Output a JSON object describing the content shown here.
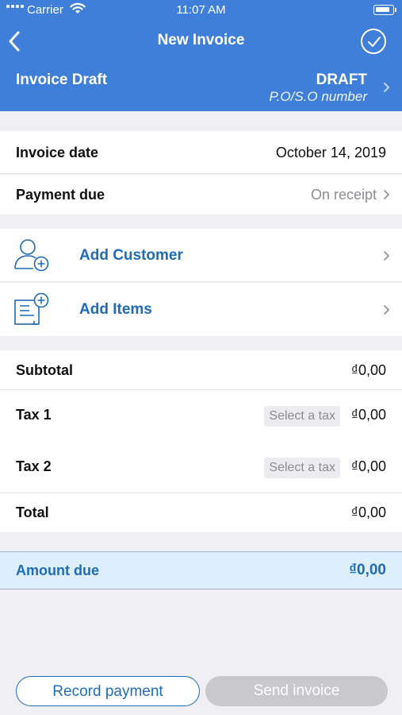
{
  "status_bar": {
    "carrier": "Carrier",
    "time": "11:07 AM"
  },
  "nav": {
    "title": "New Invoice",
    "back_icon": "chevron-left-icon",
    "done_icon": "checkmark-circle-icon"
  },
  "draft": {
    "title": "Invoice Draft",
    "status": "DRAFT",
    "po_number_placeholder": "P.O/S.O number"
  },
  "dates": {
    "invoice_date_label": "Invoice date",
    "invoice_date_value": "October 14, 2019",
    "payment_due_label": "Payment due",
    "payment_due_value": "On receipt"
  },
  "actions": {
    "add_customer": "Add Customer",
    "add_items": "Add Items"
  },
  "totals": {
    "subtotal_label": "Subtotal",
    "subtotal_value": "₫0,00",
    "tax1_label": "Tax 1",
    "tax1_select": "Select a tax",
    "tax1_value": "₫0,00",
    "tax2_label": "Tax 2",
    "tax2_select": "Select a tax",
    "tax2_value": "₫0,00",
    "total_label": "Total",
    "total_value": "₫0,00"
  },
  "amount_due": {
    "label": "Amount due",
    "value": "₫0,00"
  },
  "buttons": {
    "record_payment": "Record payment",
    "send_invoice": "Send invoice"
  },
  "colors": {
    "header_bg": "#3f7fd9",
    "accent": "#1e6bb8",
    "amount_due_bg": "#ddeefc",
    "disabled_button": "#c8c8cd"
  }
}
